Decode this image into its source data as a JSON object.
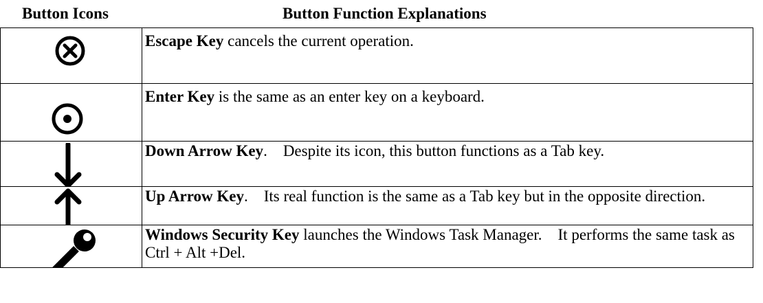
{
  "header": {
    "icons_col": "Button Icons",
    "functions_col": "Button Function Explanations"
  },
  "rows": [
    {
      "icon": "escape-x-circle-icon",
      "key": "Escape Key",
      "description": " cancels the current operation."
    },
    {
      "icon": "enter-dot-circle-icon",
      "key": "Enter Key",
      "description": " is the same as an enter key on a keyboard."
    },
    {
      "icon": "down-arrow-icon",
      "key": "Down Arrow Key",
      "description": ".    Despite its icon, this button functions as a Tab key."
    },
    {
      "icon": "up-arrow-icon",
      "key": "Up Arrow Key",
      "description": ".    Its real function is the same as a Tab key but in the opposite direction."
    },
    {
      "icon": "key-icon",
      "key": "Windows Security Key",
      "description": " launches the Windows Task Manager.    It performs the same task as Ctrl + Alt +Del."
    }
  ]
}
